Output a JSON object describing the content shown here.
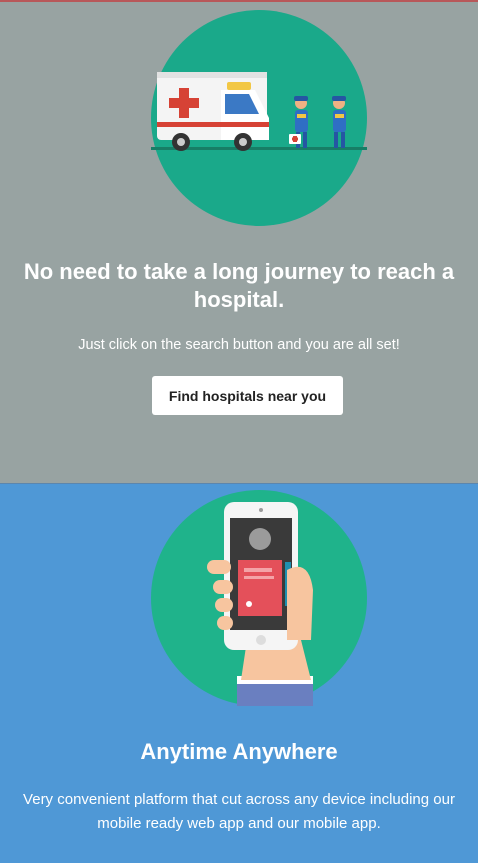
{
  "hero": {
    "title": "No need to take a long journey to reach a hospital.",
    "subtitle": "Just click on the search button and you are all set!",
    "cta_label": "Find hospitals near you",
    "bg_color": "#98a3a2",
    "circle_color": "#1aa98a",
    "illustration": "ambulance-with-paramedics-icon"
  },
  "app_section": {
    "title": "Anytime Anywhere",
    "subtitle": "Very convenient platform that cut across any device including our mobile ready web app and our mobile app.",
    "bg_color": "#4f98d6",
    "circle_color": "#1fb38b",
    "illustration": "hand-holding-phone-icon"
  }
}
